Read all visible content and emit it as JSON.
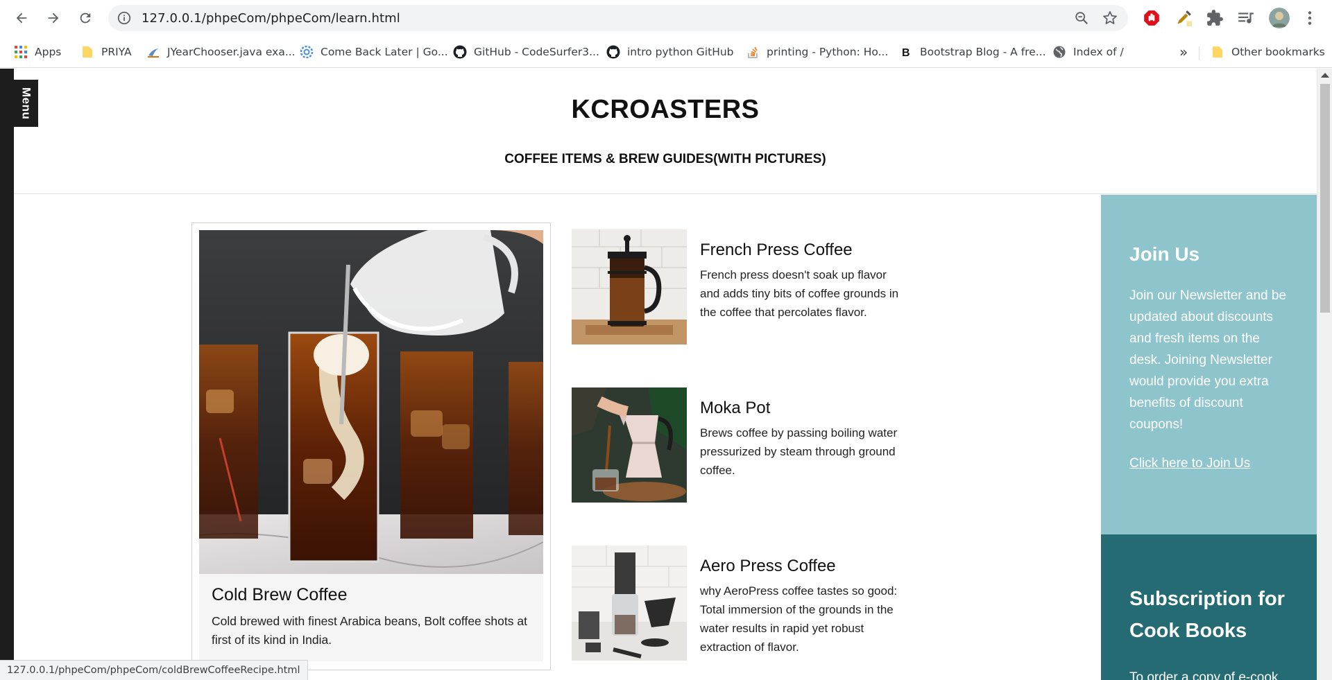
{
  "browser": {
    "url": "127.0.0.1/phpeCom/phpeCom/learn.html",
    "bookmarks": [
      {
        "label": "Apps",
        "icon": "apps-grid-icon"
      },
      {
        "label": "PRIYA",
        "icon": "folder-icon"
      },
      {
        "label": "JYearChooser.java exa...",
        "icon": "java-icon"
      },
      {
        "label": "Come Back Later | Go...",
        "icon": "gear-icon"
      },
      {
        "label": "GitHub - CodeSurfer3...",
        "icon": "github-icon"
      },
      {
        "label": "intro python GitHub",
        "icon": "github-icon"
      },
      {
        "label": "printing - Python: Ho...",
        "icon": "stackoverflow-icon"
      },
      {
        "label": "Bootstrap Blog - A fre...",
        "icon": "bootstrap-icon"
      },
      {
        "label": "Index of /",
        "icon": "globe-icon"
      }
    ],
    "more_label": "»",
    "other_bookmarks": "Other bookmarks",
    "status_url": "127.0.0.1/phpeCom/phpeCom/coldBrewCoffeeRecipe.html"
  },
  "page": {
    "menu_label": "Menu",
    "title": "KCROASTERS",
    "subtitle": "COFFEE ITEMS & BREW GUIDES(WITH PICTURES)",
    "feature": {
      "title": "Cold Brew Coffee",
      "description": "Cold brewed with finest Arabica beans, Bolt coffee shots at first of its kind in India."
    },
    "items": [
      {
        "title": "French Press Coffee",
        "description": "French press doesn't soak up flavor and adds tiny bits of coffee grounds in the coffee that percolates flavor."
      },
      {
        "title": "Moka Pot",
        "description": "Brews coffee by passing boiling water pressurized by steam through ground coffee."
      },
      {
        "title": "Aero Press Coffee",
        "description": "why AeroPress coffee tastes so good: Total immersion of the grounds in the water results in rapid yet robust extraction of flavor."
      }
    ],
    "join": {
      "heading": "Join Us",
      "text": "Join our Newsletter and be updated about discounts and fresh items on the desk. Joining Newsletter would provide you extra benefits of discount coupons!",
      "link": "Click here to Join Us"
    },
    "subscription": {
      "heading": "Subscription for Cook Books",
      "text": "To order a copy of e-cook"
    }
  },
  "colors": {
    "join_bg": "#8ec5cd",
    "subscription_bg": "#256b73",
    "menu_bg": "#1d1d1d"
  }
}
